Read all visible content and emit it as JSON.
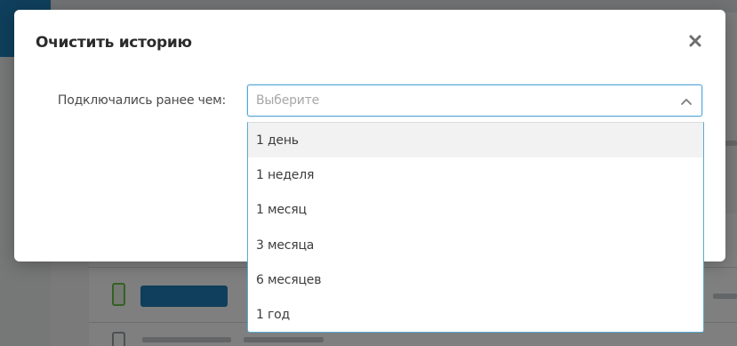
{
  "dialog": {
    "title": "Очистить историю",
    "close_icon": "close-icon"
  },
  "form": {
    "label": "Подключались ранее чем:",
    "select": {
      "placeholder": "Выберите",
      "chevron_icon": "chevron-up-icon",
      "options": [
        {
          "label": "1 день",
          "highlighted": true
        },
        {
          "label": "1 неделя",
          "highlighted": false
        },
        {
          "label": "1 месяц",
          "highlighted": false
        },
        {
          "label": "3 месяца",
          "highlighted": false
        },
        {
          "label": "6 месяцев",
          "highlighted": false
        },
        {
          "label": "1 год",
          "highlighted": false
        }
      ]
    }
  },
  "colors": {
    "accent": "#5aa9d6",
    "background_brand": "#1f7fb8",
    "placeholder_text": "#a7a7a7",
    "highlight_row": "#f2f2f2"
  }
}
